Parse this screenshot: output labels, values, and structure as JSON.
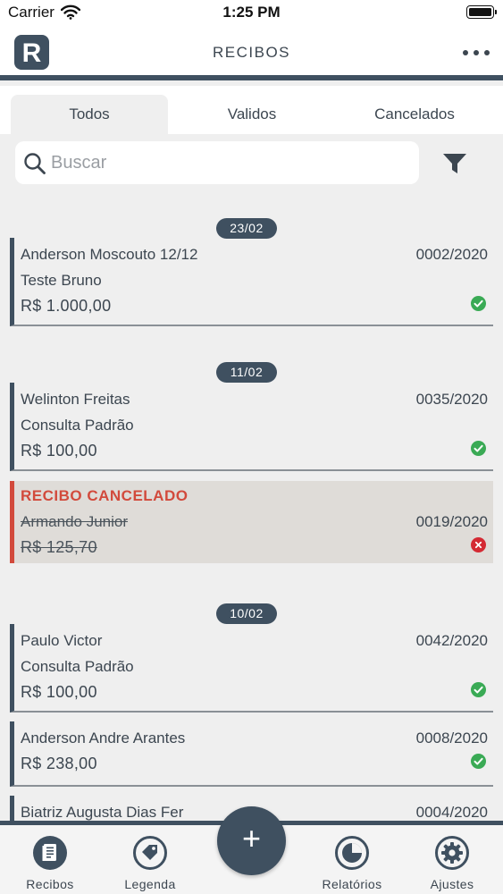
{
  "status_bar": {
    "carrier": "Carrier",
    "time": "1:25 PM"
  },
  "header": {
    "logo_letter": "R",
    "title": "RECIBOS"
  },
  "tabs": [
    {
      "label": "Todos",
      "active": true
    },
    {
      "label": "Validos",
      "active": false
    },
    {
      "label": "Cancelados",
      "active": false
    }
  ],
  "search": {
    "placeholder": "Buscar",
    "value": ""
  },
  "groups": [
    {
      "date": "23/02",
      "receipts": [
        {
          "name": "Anderson Moscouto 12/12",
          "number": "0002/2020",
          "description": "Teste Bruno",
          "amount": "R$ 1.000,00",
          "status": "valid"
        }
      ]
    },
    {
      "date": "11/02",
      "receipts": [
        {
          "name": "Welinton Freitas",
          "number": "0035/2020",
          "description": "Consulta Padrão",
          "amount": "R$ 100,00",
          "status": "valid"
        },
        {
          "cancel_label": "RECIBO CANCELADO",
          "name": "Armando Junior",
          "number": "0019/2020",
          "amount": "R$ 125,70",
          "status": "cancelled"
        }
      ]
    },
    {
      "date": "10/02",
      "receipts": [
        {
          "name": "Paulo Victor",
          "number": "0042/2020",
          "description": "Consulta Padrão",
          "amount": "R$ 100,00",
          "status": "valid"
        },
        {
          "name": "Anderson Andre Arantes",
          "number": "0008/2020",
          "amount": "R$ 238,00",
          "status": "valid"
        },
        {
          "name": "Biatriz Augusta Dias Fer",
          "number": "0004/2020"
        }
      ]
    }
  ],
  "bottom_tabs": [
    {
      "label": "Recibos",
      "icon": "receipt-icon",
      "active": true
    },
    {
      "label": "Legenda",
      "icon": "tag-icon",
      "active": false
    },
    {
      "label": "Relatórios",
      "icon": "pie-chart-icon",
      "active": false
    },
    {
      "label": "Ajustes",
      "icon": "gear-icon",
      "active": false
    }
  ],
  "fab": {
    "icon": "plus-icon",
    "label": "+"
  },
  "colors": {
    "primary": "#3f5060",
    "background": "#efefef",
    "valid": "#3aaa55",
    "cancelled": "#d24a3c",
    "cancelled_row": "#dfdcd8"
  }
}
